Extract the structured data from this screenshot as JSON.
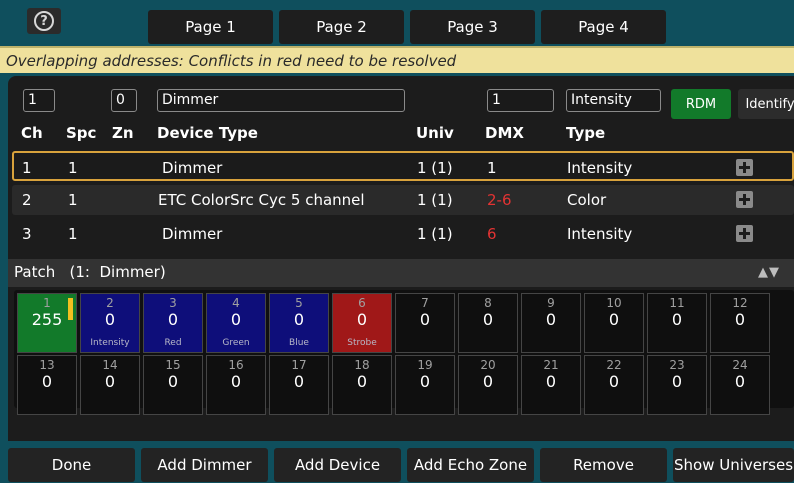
{
  "top_bar": {
    "help_icon": "question-circle-icon",
    "help_glyph": "?",
    "pages": [
      "Page 1",
      "Page 2",
      "Page 3",
      "Page 4"
    ]
  },
  "warning": "Overlapping addresses: Conflicts in red need to be resolved",
  "filters": {
    "ch": "1",
    "zn": "0",
    "device_type": "Dimmer",
    "dmx": "1",
    "type": "Intensity",
    "rdm_label": "RDM",
    "identify_label": "Identify"
  },
  "headers": [
    "Ch",
    "Spc",
    "Zn",
    "Device Type",
    "Univ",
    "DMX",
    "Type"
  ],
  "rows": [
    {
      "ch": "1",
      "spc": "1",
      "device": "Dimmer",
      "univ": "1 (1)",
      "dmx": "1",
      "type": "Intensity",
      "conflict": false
    },
    {
      "ch": "2",
      "spc": "1",
      "device": "ETC ColorSrc Cyc 5 channel",
      "univ": "1 (1)",
      "dmx": "2-6",
      "type": "Color",
      "conflict": true
    },
    {
      "ch": "3",
      "spc": "1",
      "device": "Dimmer",
      "univ": "1 (1)",
      "dmx": "6",
      "type": "Intensity",
      "conflict": true
    }
  ],
  "patch": {
    "title": "Patch   (1:  Dimmer)",
    "arrows": "▲▼",
    "tiles": [
      {
        "num": "1",
        "val": "255",
        "label": "",
        "color": "#127a2a"
      },
      {
        "num": "2",
        "val": "0",
        "label": "Intensity",
        "color": "#0e0e7a"
      },
      {
        "num": "3",
        "val": "0",
        "label": "Red",
        "color": "#0e0e7a"
      },
      {
        "num": "4",
        "val": "0",
        "label": "Green",
        "color": "#0e0e7a"
      },
      {
        "num": "5",
        "val": "0",
        "label": "Blue",
        "color": "#0e0e7a"
      },
      {
        "num": "6",
        "val": "0",
        "label": "Strobe",
        "color": "#a01818"
      },
      {
        "num": "7",
        "val": "0",
        "label": "",
        "color": ""
      },
      {
        "num": "8",
        "val": "0",
        "label": "",
        "color": ""
      },
      {
        "num": "9",
        "val": "0",
        "label": "",
        "color": ""
      },
      {
        "num": "10",
        "val": "0",
        "label": "",
        "color": ""
      },
      {
        "num": "11",
        "val": "0",
        "label": "",
        "color": ""
      },
      {
        "num": "12",
        "val": "0",
        "label": "",
        "color": ""
      },
      {
        "num": "13",
        "val": "0",
        "label": "",
        "color": ""
      },
      {
        "num": "14",
        "val": "0",
        "label": "",
        "color": ""
      },
      {
        "num": "15",
        "val": "0",
        "label": "",
        "color": ""
      },
      {
        "num": "16",
        "val": "0",
        "label": "",
        "color": ""
      },
      {
        "num": "17",
        "val": "0",
        "label": "",
        "color": ""
      },
      {
        "num": "18",
        "val": "0",
        "label": "",
        "color": ""
      },
      {
        "num": "19",
        "val": "0",
        "label": "",
        "color": ""
      },
      {
        "num": "20",
        "val": "0",
        "label": "",
        "color": ""
      },
      {
        "num": "21",
        "val": "0",
        "label": "",
        "color": ""
      },
      {
        "num": "22",
        "val": "0",
        "label": "",
        "color": ""
      },
      {
        "num": "23",
        "val": "0",
        "label": "",
        "color": ""
      },
      {
        "num": "24",
        "val": "0",
        "label": "",
        "color": ""
      }
    ]
  },
  "bottom_buttons": [
    "Done",
    "Add Dimmer",
    "Add Device",
    "Add Echo Zone",
    "Remove",
    "Show Universes"
  ],
  "colors": {
    "accent_green": "#127a2a",
    "conflict_red": "#e33333",
    "warning_bg": "#efe19c",
    "selected_border": "#d8a23c"
  }
}
